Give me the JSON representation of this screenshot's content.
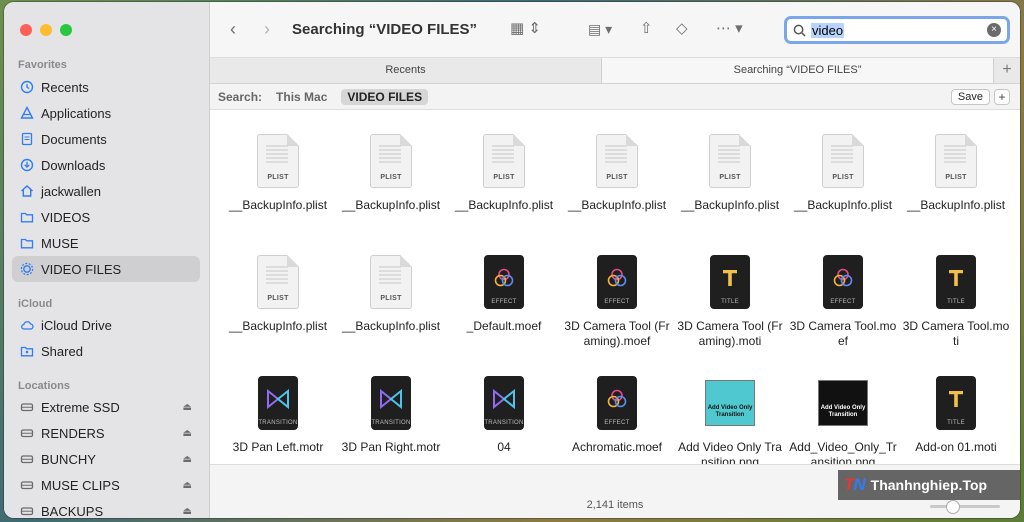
{
  "sidebar": {
    "sections": {
      "favorites": "Favorites",
      "icloud": "iCloud",
      "locations": "Locations"
    },
    "favorites": [
      {
        "label": "Recents",
        "icon": "clock-icon"
      },
      {
        "label": "Applications",
        "icon": "applications-icon"
      },
      {
        "label": "Documents",
        "icon": "document-icon"
      },
      {
        "label": "Downloads",
        "icon": "download-icon"
      },
      {
        "label": "jackwallen",
        "icon": "home-icon"
      },
      {
        "label": "VIDEOS",
        "icon": "folder-icon"
      },
      {
        "label": "MUSE",
        "icon": "folder-icon"
      },
      {
        "label": "VIDEO FILES",
        "icon": "gear-icon"
      }
    ],
    "icloud": [
      {
        "label": "iCloud Drive",
        "icon": "cloud-icon"
      },
      {
        "label": "Shared",
        "icon": "shared-folder-icon"
      }
    ],
    "locations": [
      {
        "label": "Extreme SSD",
        "icon": "disk-icon"
      },
      {
        "label": "RENDERS",
        "icon": "disk-icon"
      },
      {
        "label": "BUNCHY",
        "icon": "disk-icon"
      },
      {
        "label": "MUSE CLIPS",
        "icon": "disk-icon"
      },
      {
        "label": "BACKUPS",
        "icon": "disk-icon"
      }
    ]
  },
  "toolbar": {
    "title": "Searching “VIDEO FILES”",
    "search_value": "video"
  },
  "tabs": [
    {
      "label": "Recents"
    },
    {
      "label": "Searching “VIDEO FILES”"
    }
  ],
  "scope": {
    "label": "Search:",
    "options": [
      "This Mac",
      "VIDEO FILES"
    ],
    "save": "Save",
    "add": "+"
  },
  "files": [
    {
      "name": "__BackupInfo.plist",
      "kind": "plist",
      "tag": "PLIST"
    },
    {
      "name": "__BackupInfo.plist",
      "kind": "plist",
      "tag": "PLIST"
    },
    {
      "name": "__BackupInfo.plist",
      "kind": "plist",
      "tag": "PLIST"
    },
    {
      "name": "__BackupInfo.plist",
      "kind": "plist",
      "tag": "PLIST"
    },
    {
      "name": "__BackupInfo.plist",
      "kind": "plist",
      "tag": "PLIST"
    },
    {
      "name": "__BackupInfo.plist",
      "kind": "plist",
      "tag": "PLIST"
    },
    {
      "name": "__BackupInfo.plist",
      "kind": "plist",
      "tag": "PLIST"
    },
    {
      "name": "__BackupInfo.plist",
      "kind": "plist",
      "tag": "PLIST"
    },
    {
      "name": "__BackupInfo.plist",
      "kind": "plist",
      "tag": "PLIST"
    },
    {
      "name": "_Default.moef",
      "kind": "effect",
      "tag": "EFFECT"
    },
    {
      "name": "3D Camera Tool (Framing).moef",
      "kind": "effect",
      "tag": "EFFECT"
    },
    {
      "name": "3D Camera Tool (Framing).moti",
      "kind": "title",
      "tag": "TITLE"
    },
    {
      "name": "3D Camera Tool.moef",
      "kind": "effect",
      "tag": "EFFECT"
    },
    {
      "name": "3D Camera Tool.moti",
      "kind": "title",
      "tag": "TITLE"
    },
    {
      "name": "3D Pan Left.motr",
      "kind": "transition",
      "tag": "TRANSITION"
    },
    {
      "name": "3D Pan Right.motr",
      "kind": "transition",
      "tag": "TRANSITION"
    },
    {
      "name": "04",
      "kind": "transition",
      "tag": "TRANSITION"
    },
    {
      "name": "Achromatic.moef",
      "kind": "effect",
      "tag": "EFFECT"
    },
    {
      "name": "Add Video Only Transition.png",
      "kind": "image-light",
      "tag": "Add Video Only Transition"
    },
    {
      "name": "Add_Video_Only_Transition.png",
      "kind": "image-dark",
      "tag": "Add Video Only Transition"
    },
    {
      "name": "Add-on 01.moti",
      "kind": "title",
      "tag": "TITLE"
    }
  ],
  "status": {
    "count": "2,141 items"
  },
  "watermark": {
    "logo_a": "T",
    "logo_b": "N",
    "text": "Thanhnghiep.Top"
  }
}
